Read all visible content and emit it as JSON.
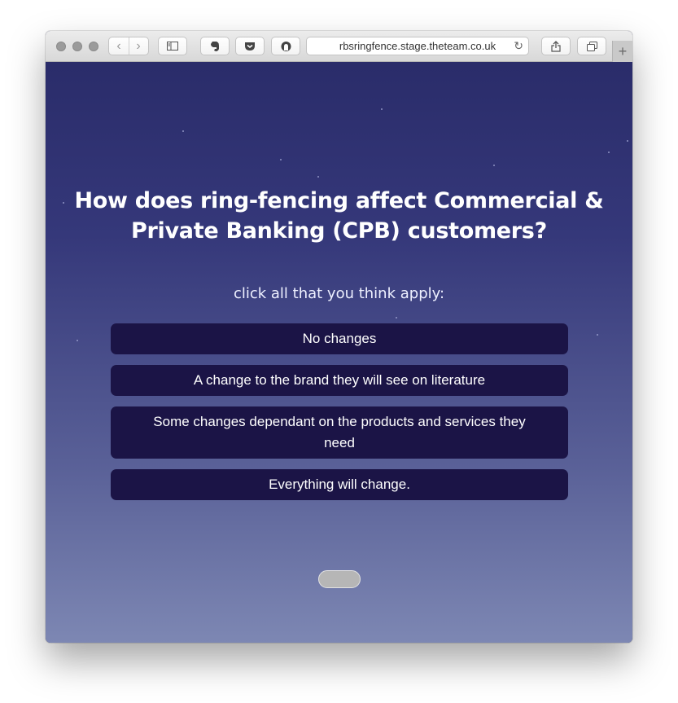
{
  "browser": {
    "url": "rbsringfence.stage.theteam.co.uk",
    "toolbar_icons": [
      "back-icon",
      "forward-icon",
      "sidebar-icon",
      "evernote-icon",
      "pocket-icon",
      "ghostery-icon",
      "reload-icon",
      "share-icon",
      "tabs-icon",
      "new-tab-icon"
    ]
  },
  "quiz": {
    "question": "How does ring-fencing affect Commercial & Private Banking (CPB) customers?",
    "instruction": "click all that you think apply:",
    "options": [
      {
        "label": "No changes"
      },
      {
        "label": "A change to the brand they will see on literature"
      },
      {
        "label": "Some changes dependant on the products and services they need"
      },
      {
        "label": "Everything will change."
      }
    ]
  },
  "colors": {
    "background_top": "#2a2c6a",
    "background_bottom": "#7d87b3",
    "option_bg": "#1b1446",
    "submit_bg": "#b6b6b6"
  }
}
